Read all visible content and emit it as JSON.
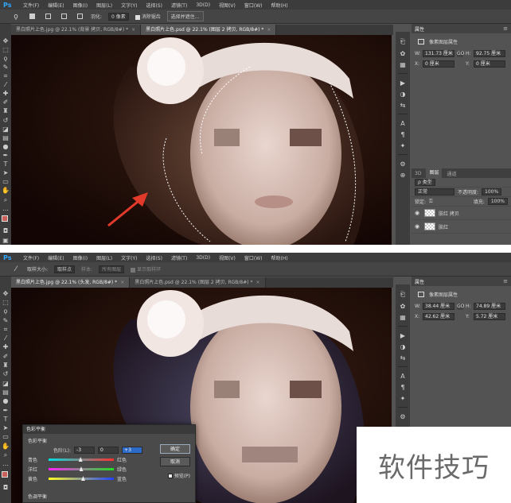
{
  "menu": {
    "logo": "Ps",
    "items": [
      "文件(F)",
      "编辑(E)",
      "图像(I)",
      "图层(L)",
      "文字(Y)",
      "选择(S)",
      "滤镜(T)",
      "3D(D)",
      "视图(V)",
      "窗口(W)",
      "帮助(H)"
    ]
  },
  "shot1": {
    "options": {
      "feather_label": "羽化:",
      "feather_value": "0 像素",
      "antialias_label": "消除锯齿",
      "select_mask_button": "选择并遮住..."
    },
    "tabs": [
      {
        "label": "黑白照片上色.jpg @ 22.1% (背景 拷贝, RGB/8#) *",
        "active": false
      },
      {
        "label": "黑白照片上色.psd @ 22.1% (图层 2 拷贝, RGB/8#) *",
        "active": true
      }
    ],
    "properties": {
      "tab": "属性",
      "title": "像素图层属性",
      "w_label": "W:",
      "w_value": "131.73 厘米",
      "h_label": "H:",
      "h_value": "92.75 厘米",
      "x_label": "X:",
      "x_value": "0 厘米",
      "y_label": "Y:",
      "y_value": "0 厘米",
      "link": "GO"
    },
    "layers": {
      "tabs": [
        "3D",
        "图层",
        "通道"
      ],
      "active_tab": "图层",
      "filter_kind": "ρ 类型",
      "blend_mode": "正常",
      "opacity_label": "不透明度:",
      "opacity_value": "100%",
      "lock_label": "锁定:",
      "fill_label": "填充:",
      "fill_value": "100%",
      "items": [
        "肤红 拷贝",
        "肤红"
      ]
    }
  },
  "shot2": {
    "options": {
      "size_label": "取样大小:",
      "size_value": "取样点",
      "sample_label": "样本:",
      "sample_value": "所有图层",
      "show_ring_label": "显示取样环"
    },
    "tabs": [
      {
        "label": "黑白照片上色.jpg @ 22.1% (头发, RGB/8#) *",
        "active": true
      },
      {
        "label": "黑白照片上色.psd @ 22.1% (图层 2 拷贝, RGB/8#) *",
        "active": false
      }
    ],
    "properties": {
      "tab": "属性",
      "title": "像素图层属性",
      "w_label": "W:",
      "w_value": "38.44 厘米",
      "h_label": "H:",
      "h_value": "74.89 厘米",
      "x_label": "X:",
      "x_value": "42.62 厘米",
      "y_label": "Y:",
      "y_value": "5.72 厘米",
      "link": "GO"
    },
    "dialog": {
      "title": "色彩平衡",
      "group_title": "色彩平衡",
      "levels_label": "色阶(L):",
      "levels": [
        "-3",
        "0",
        "+3"
      ],
      "sliders": [
        {
          "left": "青色",
          "right": "红色",
          "value": 0.49
        },
        {
          "left": "洋红",
          "right": "绿色",
          "value": 0.5
        },
        {
          "left": "黄色",
          "right": "蓝色",
          "value": 0.53
        }
      ],
      "ok_button": "确定",
      "cancel_button": "取消",
      "preview_label": "预览(P)",
      "tone_group_title": "色调平衡"
    }
  },
  "watermark": {
    "text": "软件技巧"
  },
  "colors": {
    "foreground": "#c9605a",
    "background": "#ffffff",
    "accent": "#2d6bc9",
    "arrow": "#e23a2a"
  }
}
